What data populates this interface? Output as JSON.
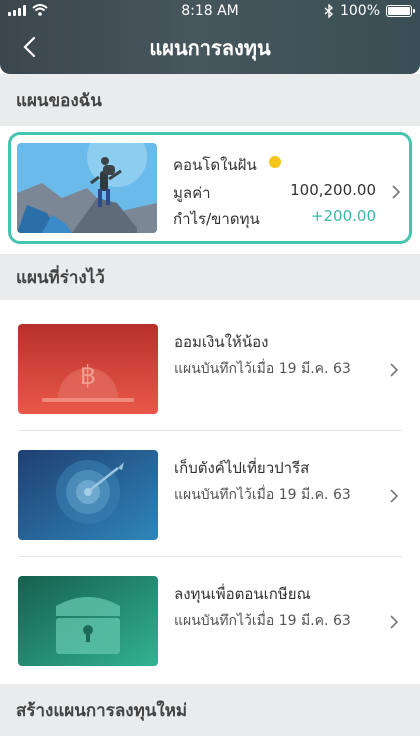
{
  "status": {
    "time": "8:18 AM",
    "battery": "100%"
  },
  "header": {
    "title": "แผนการลงทุน"
  },
  "my_plan": {
    "section_title": "แผนของฉัน",
    "name": "คอนโดในฝัน",
    "value_label": "มูลค่า",
    "value": "100,200.00",
    "profit_label": "กำไร/ขาดทุน",
    "profit": "+200.00"
  },
  "drafts": {
    "section_title": "แผนที่ร่างไว้",
    "items": [
      {
        "title": "ออมเงินให้น้อง",
        "subtitle": "แผนบันทึกไว้เมื่อ 19 มี.ค. 63",
        "icon": "baht-coin-icon"
      },
      {
        "title": "เก็บตังค์ไปเที่ยวปารีส",
        "subtitle": "แผนบันทึกไว้เมื่อ 19 มี.ค. 63",
        "icon": "target-icon"
      },
      {
        "title": "ลงทุนเพื่อตอนเกษียณ",
        "subtitle": "แผนบันทึกไว้เมื่อ 19 มี.ค. 63",
        "icon": "treasure-chest-icon"
      }
    ]
  },
  "create": {
    "section_title": "สร้างแผนการลงทุนใหม่"
  },
  "colors": {
    "accent": "#45c4b0",
    "header": "#3f4d54",
    "dot": "#f5c518"
  }
}
